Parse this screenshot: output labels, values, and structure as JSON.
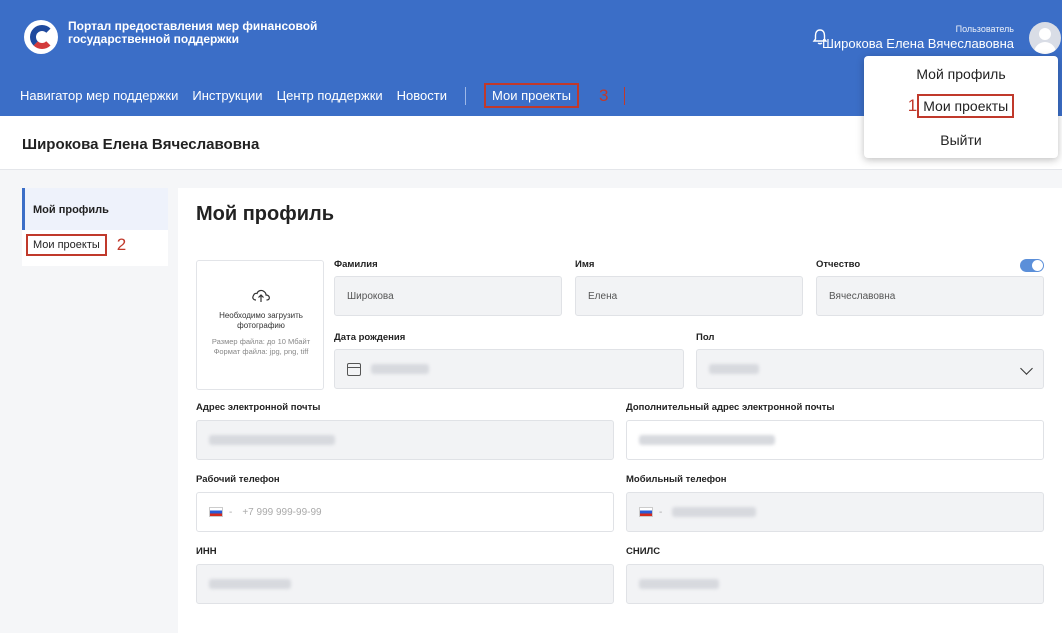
{
  "header": {
    "portal_title": "Портал предоставления мер финансовой государственной поддержки",
    "user_role": "Пользователь",
    "user_name": "Широкова Елена Вячеславовна",
    "brand_color": "#3b6ec7"
  },
  "nav": {
    "items": [
      "Навигатор мер поддержки",
      "Инструкции",
      "Центр поддержки",
      "Новости"
    ],
    "highlighted": "Мои проекты",
    "highlight_marker": "3"
  },
  "user_menu": {
    "items": [
      "Мой профиль",
      "Мои проекты",
      "Выйти"
    ],
    "highlight_marker": "1"
  },
  "subheader": {
    "name": "Широкова Елена Вячеславовна"
  },
  "sidebar": {
    "items": [
      "Мой профиль",
      "Мои проекты"
    ],
    "highlight_marker": "2"
  },
  "profile": {
    "title": "Мой профиль",
    "photo": {
      "hint": "Необходимо загрузить фотографию",
      "size": "Размер файла: до 10 Мбайт",
      "format": "Формат файла: jpg, png, tiff"
    },
    "fields": {
      "last_name": {
        "label": "Фамилия",
        "value": "Широкова"
      },
      "first_name": {
        "label": "Имя",
        "value": "Елена"
      },
      "patronymic": {
        "label": "Отчество",
        "value": "Вячеславовна"
      },
      "birth_date": {
        "label": "Дата рождения"
      },
      "gender": {
        "label": "Пол"
      },
      "email": {
        "label": "Адрес электронной почты"
      },
      "extra_email": {
        "label": "Дополнительный адрес электронной почты"
      },
      "work_phone": {
        "label": "Рабочий телефон",
        "placeholder": "+7 999 999-99-99"
      },
      "mobile_phone": {
        "label": "Мобильный телефон"
      },
      "inn": {
        "label": "ИНН"
      },
      "snils": {
        "label": "СНИЛС"
      }
    },
    "patronymic_toggle": "on"
  },
  "icons": [
    "bell-icon",
    "avatar-icon",
    "upload-cloud-icon",
    "calendar-icon",
    "chevron-down-icon",
    "russia-flag-icon"
  ]
}
